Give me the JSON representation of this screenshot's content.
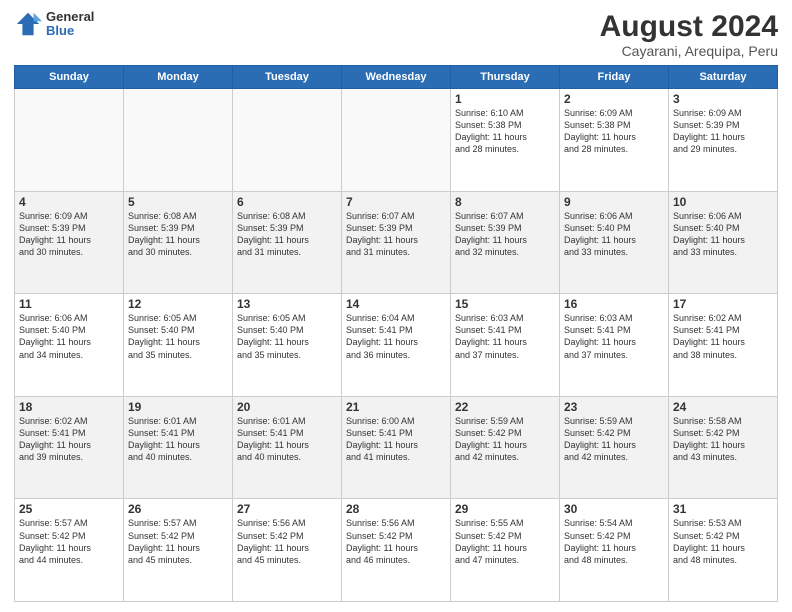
{
  "header": {
    "logo_general": "General",
    "logo_blue": "Blue",
    "month_year": "August 2024",
    "location": "Cayarani, Arequipa, Peru"
  },
  "days_of_week": [
    "Sunday",
    "Monday",
    "Tuesday",
    "Wednesday",
    "Thursday",
    "Friday",
    "Saturday"
  ],
  "weeks": [
    [
      {
        "day": "",
        "info": ""
      },
      {
        "day": "",
        "info": ""
      },
      {
        "day": "",
        "info": ""
      },
      {
        "day": "",
        "info": ""
      },
      {
        "day": "1",
        "info": "Sunrise: 6:10 AM\nSunset: 5:38 PM\nDaylight: 11 hours\nand 28 minutes."
      },
      {
        "day": "2",
        "info": "Sunrise: 6:09 AM\nSunset: 5:38 PM\nDaylight: 11 hours\nand 28 minutes."
      },
      {
        "day": "3",
        "info": "Sunrise: 6:09 AM\nSunset: 5:39 PM\nDaylight: 11 hours\nand 29 minutes."
      }
    ],
    [
      {
        "day": "4",
        "info": "Sunrise: 6:09 AM\nSunset: 5:39 PM\nDaylight: 11 hours\nand 30 minutes."
      },
      {
        "day": "5",
        "info": "Sunrise: 6:08 AM\nSunset: 5:39 PM\nDaylight: 11 hours\nand 30 minutes."
      },
      {
        "day": "6",
        "info": "Sunrise: 6:08 AM\nSunset: 5:39 PM\nDaylight: 11 hours\nand 31 minutes."
      },
      {
        "day": "7",
        "info": "Sunrise: 6:07 AM\nSunset: 5:39 PM\nDaylight: 11 hours\nand 31 minutes."
      },
      {
        "day": "8",
        "info": "Sunrise: 6:07 AM\nSunset: 5:39 PM\nDaylight: 11 hours\nand 32 minutes."
      },
      {
        "day": "9",
        "info": "Sunrise: 6:06 AM\nSunset: 5:40 PM\nDaylight: 11 hours\nand 33 minutes."
      },
      {
        "day": "10",
        "info": "Sunrise: 6:06 AM\nSunset: 5:40 PM\nDaylight: 11 hours\nand 33 minutes."
      }
    ],
    [
      {
        "day": "11",
        "info": "Sunrise: 6:06 AM\nSunset: 5:40 PM\nDaylight: 11 hours\nand 34 minutes."
      },
      {
        "day": "12",
        "info": "Sunrise: 6:05 AM\nSunset: 5:40 PM\nDaylight: 11 hours\nand 35 minutes."
      },
      {
        "day": "13",
        "info": "Sunrise: 6:05 AM\nSunset: 5:40 PM\nDaylight: 11 hours\nand 35 minutes."
      },
      {
        "day": "14",
        "info": "Sunrise: 6:04 AM\nSunset: 5:41 PM\nDaylight: 11 hours\nand 36 minutes."
      },
      {
        "day": "15",
        "info": "Sunrise: 6:03 AM\nSunset: 5:41 PM\nDaylight: 11 hours\nand 37 minutes."
      },
      {
        "day": "16",
        "info": "Sunrise: 6:03 AM\nSunset: 5:41 PM\nDaylight: 11 hours\nand 37 minutes."
      },
      {
        "day": "17",
        "info": "Sunrise: 6:02 AM\nSunset: 5:41 PM\nDaylight: 11 hours\nand 38 minutes."
      }
    ],
    [
      {
        "day": "18",
        "info": "Sunrise: 6:02 AM\nSunset: 5:41 PM\nDaylight: 11 hours\nand 39 minutes."
      },
      {
        "day": "19",
        "info": "Sunrise: 6:01 AM\nSunset: 5:41 PM\nDaylight: 11 hours\nand 40 minutes."
      },
      {
        "day": "20",
        "info": "Sunrise: 6:01 AM\nSunset: 5:41 PM\nDaylight: 11 hours\nand 40 minutes."
      },
      {
        "day": "21",
        "info": "Sunrise: 6:00 AM\nSunset: 5:41 PM\nDaylight: 11 hours\nand 41 minutes."
      },
      {
        "day": "22",
        "info": "Sunrise: 5:59 AM\nSunset: 5:42 PM\nDaylight: 11 hours\nand 42 minutes."
      },
      {
        "day": "23",
        "info": "Sunrise: 5:59 AM\nSunset: 5:42 PM\nDaylight: 11 hours\nand 42 minutes."
      },
      {
        "day": "24",
        "info": "Sunrise: 5:58 AM\nSunset: 5:42 PM\nDaylight: 11 hours\nand 43 minutes."
      }
    ],
    [
      {
        "day": "25",
        "info": "Sunrise: 5:57 AM\nSunset: 5:42 PM\nDaylight: 11 hours\nand 44 minutes."
      },
      {
        "day": "26",
        "info": "Sunrise: 5:57 AM\nSunset: 5:42 PM\nDaylight: 11 hours\nand 45 minutes."
      },
      {
        "day": "27",
        "info": "Sunrise: 5:56 AM\nSunset: 5:42 PM\nDaylight: 11 hours\nand 45 minutes."
      },
      {
        "day": "28",
        "info": "Sunrise: 5:56 AM\nSunset: 5:42 PM\nDaylight: 11 hours\nand 46 minutes."
      },
      {
        "day": "29",
        "info": "Sunrise: 5:55 AM\nSunset: 5:42 PM\nDaylight: 11 hours\nand 47 minutes."
      },
      {
        "day": "30",
        "info": "Sunrise: 5:54 AM\nSunset: 5:42 PM\nDaylight: 11 hours\nand 48 minutes."
      },
      {
        "day": "31",
        "info": "Sunrise: 5:53 AM\nSunset: 5:42 PM\nDaylight: 11 hours\nand 48 minutes."
      }
    ]
  ]
}
